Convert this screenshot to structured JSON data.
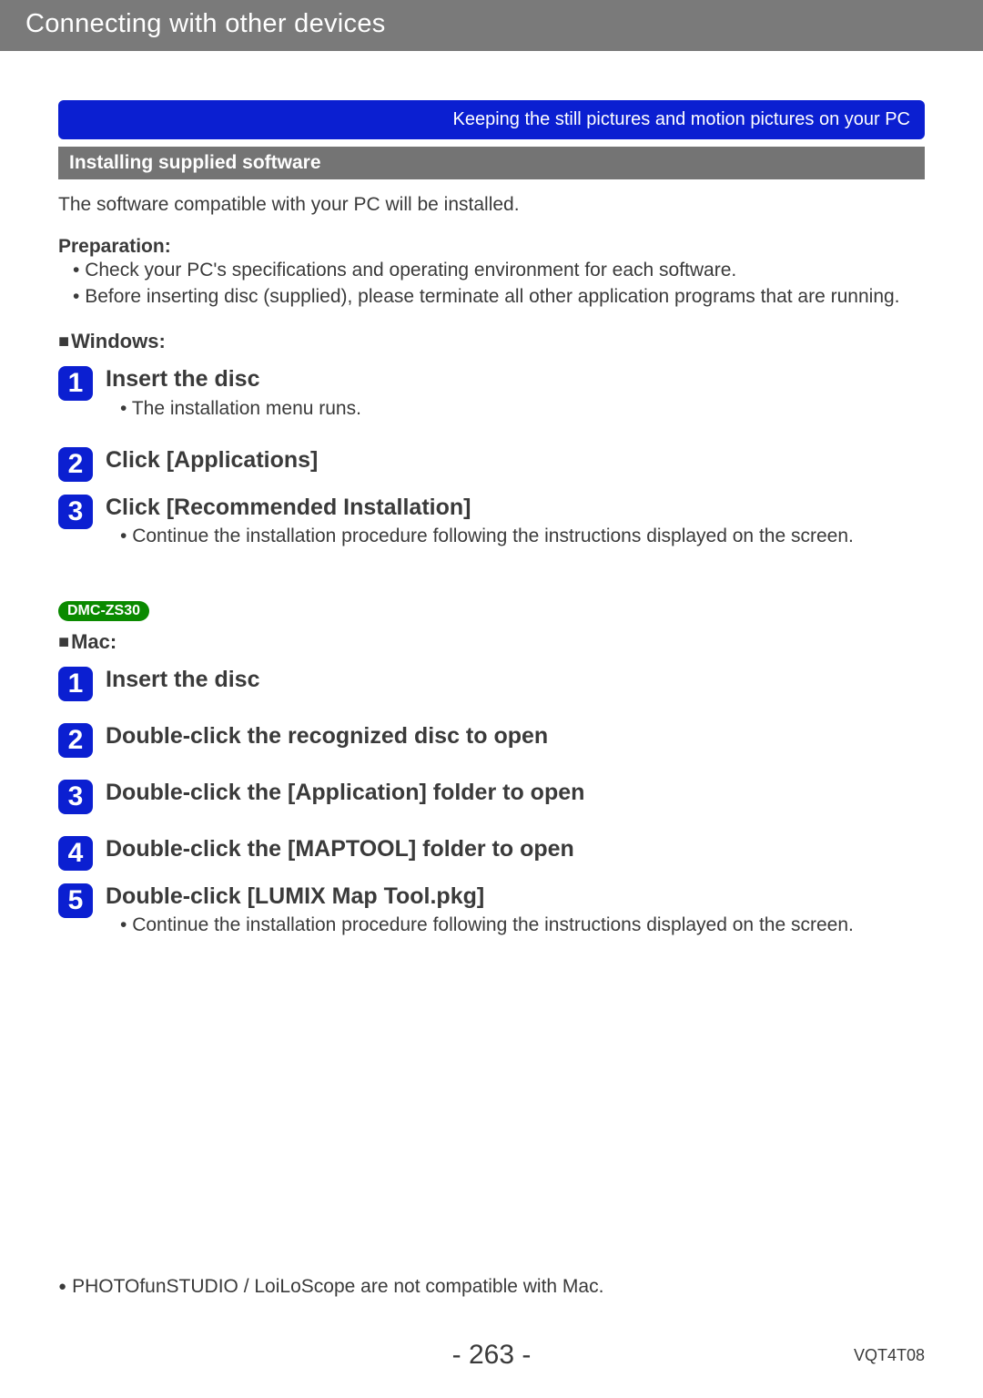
{
  "header": {
    "title": "Connecting with other devices"
  },
  "blueBanner": "Keeping the still pictures and motion pictures on your PC",
  "graySub": "Installing supplied software",
  "intro": "The software compatible with your PC will be installed.",
  "prepLabel": "Preparation:",
  "prepBullets": [
    "Check your PC's specifications and operating environment for each software.",
    "Before inserting disc (supplied), please terminate all other application programs that are running."
  ],
  "windowsLabel": "Windows:",
  "winSteps": [
    {
      "n": "1",
      "title": "Insert the disc",
      "bullets": [
        "The installation menu runs."
      ]
    },
    {
      "n": "2",
      "title": "Click [Applications]",
      "bullets": []
    },
    {
      "n": "3",
      "title": "Click [Recommended Installation]",
      "bullets": [
        "Continue the installation procedure following the instructions displayed on the screen."
      ]
    }
  ],
  "modelTag": "DMC-ZS30",
  "macLabel": "Mac:",
  "macSteps": [
    {
      "n": "1",
      "title": "Insert the disc",
      "bullets": []
    },
    {
      "n": "2",
      "title": "Double-click the recognized disc to open",
      "bullets": []
    },
    {
      "n": "3",
      "title": "Double-click the [Application] folder to open",
      "bullets": []
    },
    {
      "n": "4",
      "title": "Double-click the [MAPTOOL] folder to open",
      "bullets": []
    },
    {
      "n": "5",
      "title": "Double-click [LUMIX Map Tool.pkg]",
      "bullets": [
        "Continue the installation procedure following the instructions displayed on the screen."
      ]
    }
  ],
  "note": "PHOTOfunSTUDIO / LoiLoScope are not compatible with Mac.",
  "pageNumber": "- 263 -",
  "docCode": "VQT4T08"
}
